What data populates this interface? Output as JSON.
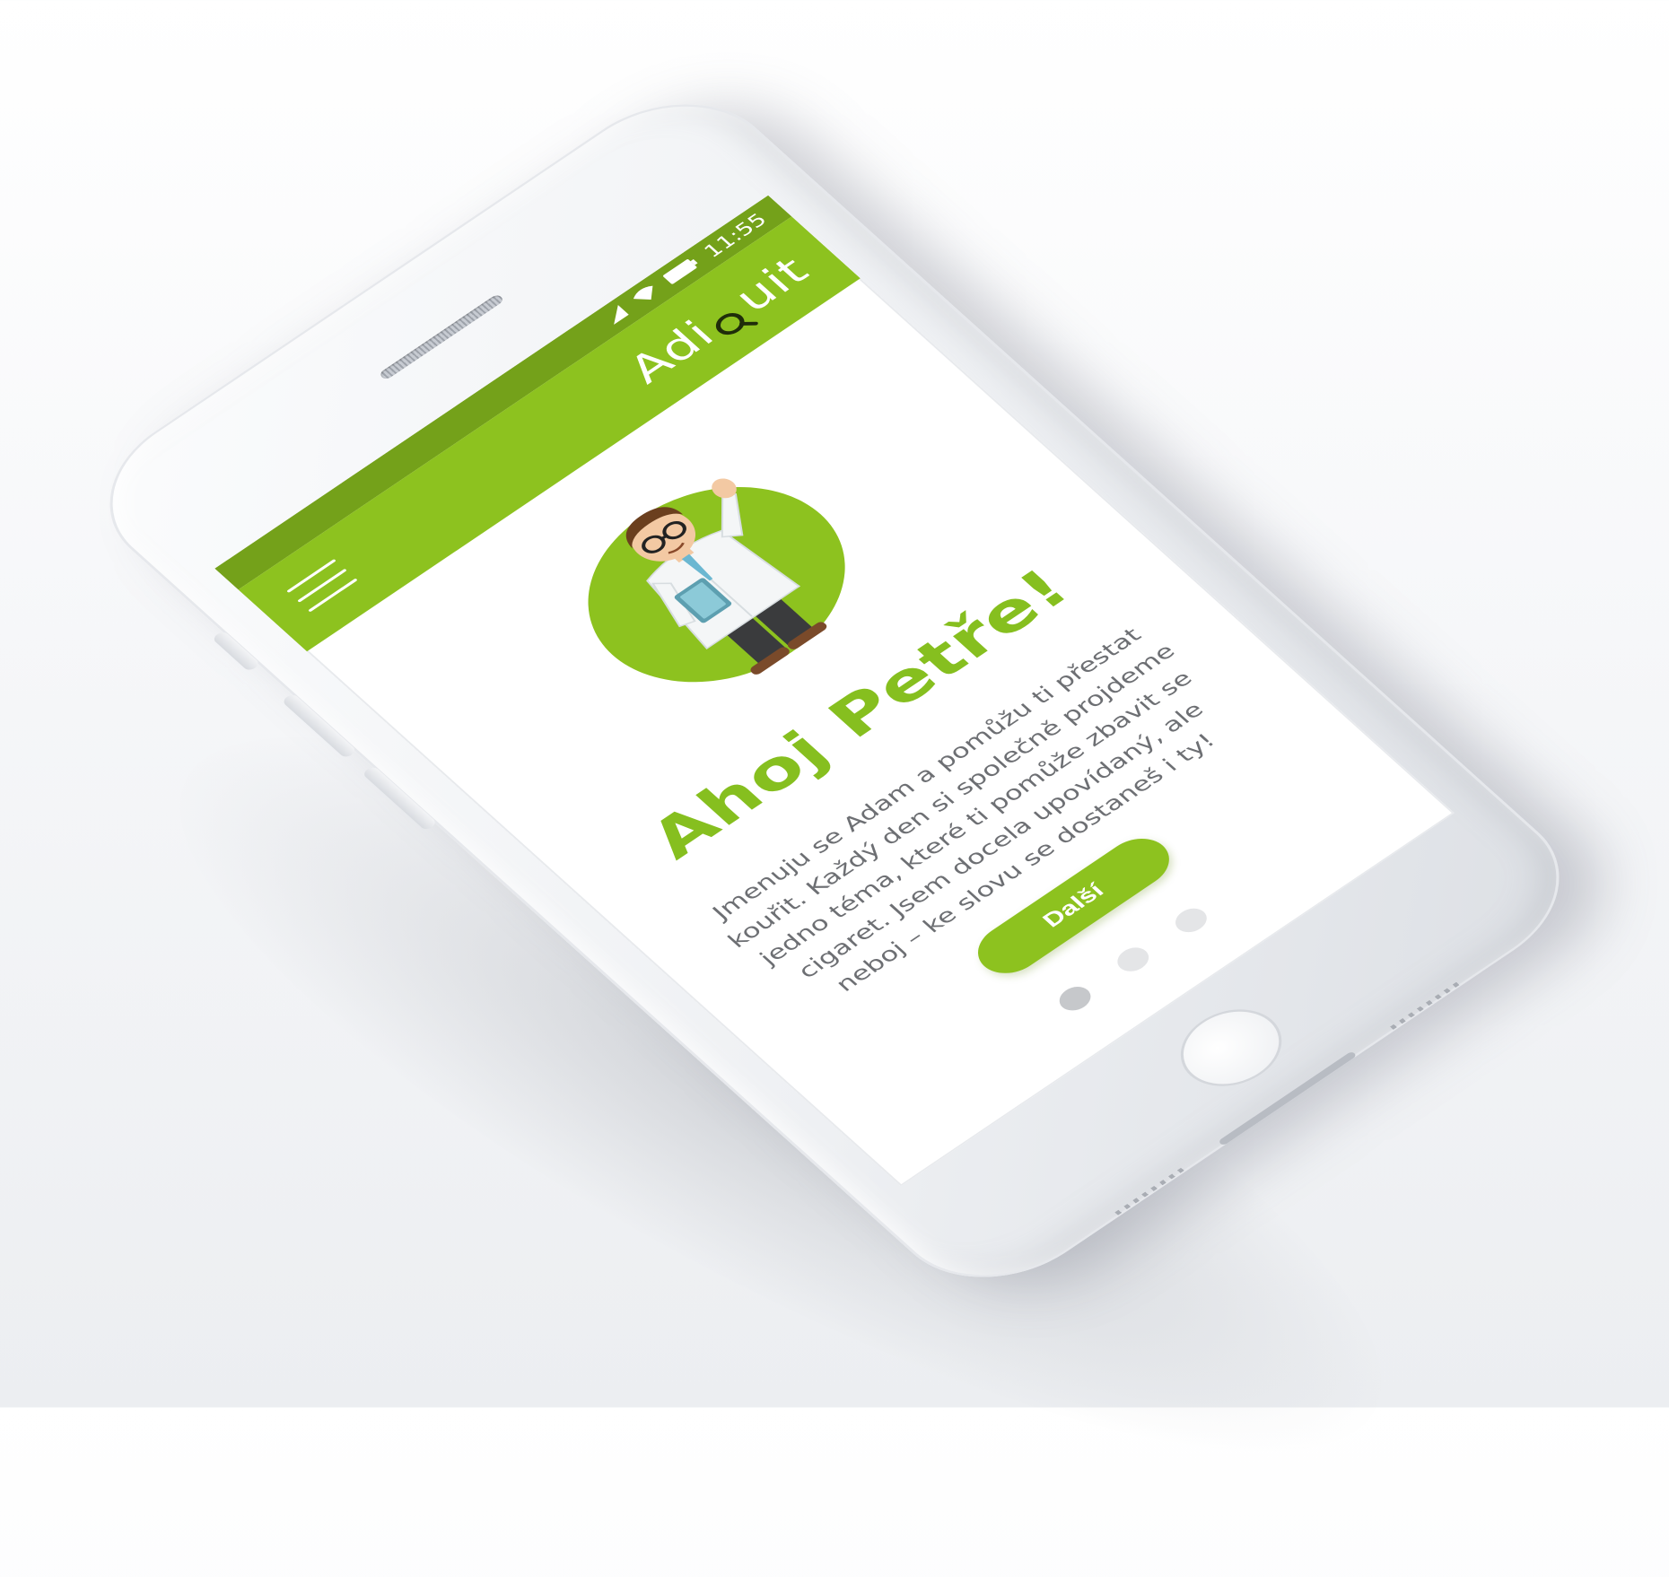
{
  "status_bar": {
    "time": "11:55",
    "icons": [
      "signal-icon",
      "wifi-icon",
      "battery-icon"
    ]
  },
  "app_bar": {
    "logo_prefix": "Adi",
    "logo_suffix": "uit",
    "logo_glyph": "magnifier-q-icon",
    "menu_icon": "hamburger-menu-icon"
  },
  "content": {
    "greeting": "Ahoj Petře!",
    "intro": "Jmenuju se Adam a pomůžu ti přestat kouřit. Každý den si společně projdeme jedno téma, které ti pomůže zbavit se cigaret. Jsem docela upovídaný, ale neboj – ke slovu se dostaneš i ty!",
    "next_label": "Další",
    "illustration": "doctor-waving-illustration"
  },
  "pager": {
    "count": 3,
    "active_index": 0
  },
  "colors": {
    "brand_green": "#8dc21f",
    "status_green": "#74a11a",
    "text_gray": "#6d6f73",
    "dot_active": "#c6c8cb",
    "dot_inactive": "#e4e5e7"
  }
}
